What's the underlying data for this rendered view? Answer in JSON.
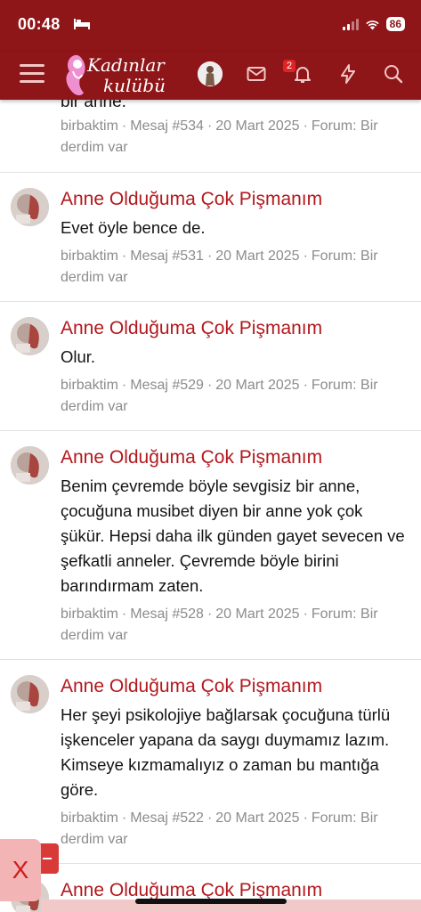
{
  "status_bar": {
    "time": "00:48",
    "battery": "86"
  },
  "header": {
    "logo_line1": "Kadınlar",
    "logo_line2": "kulübü",
    "notification_count": "2",
    "icons": [
      "menu-icon",
      "avatar",
      "mail-icon",
      "bell-icon",
      "bolt-icon",
      "search-icon"
    ]
  },
  "colors": {
    "brand": "#8e1518",
    "title": "#b3181d",
    "meta": "#8c8c8c"
  },
  "partial_post": {
    "content": "bir anne.",
    "author": "birbaktim",
    "message": "Mesaj #534",
    "date": "20 Mart 2025",
    "forum_prefix": "Forum:",
    "forum": "Bir derdim var"
  },
  "posts": [
    {
      "title": "Anne Olduğuma Çok Pişmanım",
      "content": "Evet öyle bence de.",
      "author": "birbaktim",
      "message": "Mesaj #531",
      "date": "20 Mart 2025",
      "forum_prefix": "Forum:",
      "forum": "Bir derdim var"
    },
    {
      "title": "Anne Olduğuma Çok Pişmanım",
      "content": "Olur.",
      "author": "birbaktim",
      "message": "Mesaj #529",
      "date": "20 Mart 2025",
      "forum_prefix": "Forum:",
      "forum": "Bir derdim var"
    },
    {
      "title": "Anne Olduğuma Çok Pişmanım",
      "content": "Benim çevremde böyle sevgisiz bir anne, çocuğuna musibet diyen bir anne yok çok şükür. Hepsi daha ilk günden gayet sevecen ve şefkatli anneler. Çevremde böyle birini barındırmam zaten.",
      "author": "birbaktim",
      "message": "Mesaj #528",
      "date": "20 Mart 2025",
      "forum_prefix": "Forum:",
      "forum": "Bir derdim var"
    },
    {
      "title": "Anne Olduğuma Çok Pişmanım",
      "content": "Her şeyi psikolojiye bağlarsak çocuğuna türlü işkenceler yapana da saygı duymamız lazım. Kimseye kızmamalıyız o zaman bu mantığa göre.",
      "author": "birbaktim",
      "message": "Mesaj #522",
      "date": "20 Mart 2025",
      "forum_prefix": "Forum:",
      "forum": "Bir derdim var"
    },
    {
      "title": "Anne Olduğuma Çok Pişmanım"
    }
  ],
  "close_button_label": "X"
}
